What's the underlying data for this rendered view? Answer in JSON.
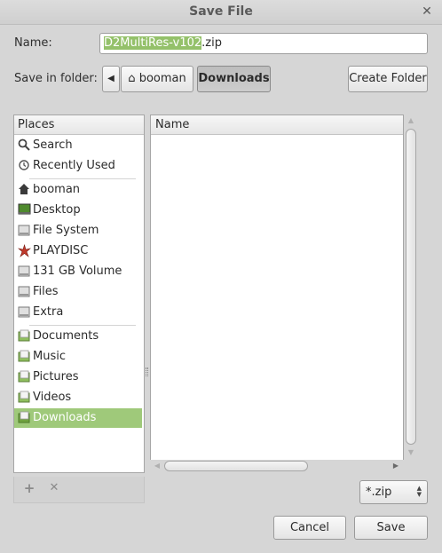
{
  "window": {
    "title": "Save File"
  },
  "name": {
    "label": "Name:",
    "value_selected": "D2MultiRes-v102",
    "value_ext": ".zip"
  },
  "folder": {
    "label": "Save in folder:",
    "back_icon": "triangle-left-icon",
    "crumbs": [
      {
        "label": "booman",
        "icon": "home-icon"
      },
      {
        "label": "Downloads"
      }
    ],
    "create_folder_label": "Create Folder"
  },
  "places": {
    "header": "Places",
    "items": [
      {
        "label": "Search",
        "icon": "search-icon"
      },
      {
        "label": "Recently Used",
        "icon": "recent-icon"
      },
      {
        "label": "booman",
        "icon": "home-icon"
      },
      {
        "label": "Desktop",
        "icon": "desktop-icon"
      },
      {
        "label": "File System",
        "icon": "drive-icon"
      },
      {
        "label": "PLAYDISC",
        "icon": "disc-icon"
      },
      {
        "label": "131 GB Volume",
        "icon": "drive-icon"
      },
      {
        "label": "Files",
        "icon": "drive-icon"
      },
      {
        "label": "Extra",
        "icon": "drive-icon"
      },
      {
        "label": "Documents",
        "icon": "folder-icon"
      },
      {
        "label": "Music",
        "icon": "folder-icon"
      },
      {
        "label": "Pictures",
        "icon": "folder-icon"
      },
      {
        "label": "Videos",
        "icon": "folder-icon"
      },
      {
        "label": "Downloads",
        "icon": "folder-icon",
        "selected": true
      }
    ],
    "add_icon": "plus-icon",
    "remove_icon": "x-icon"
  },
  "files": {
    "column_name": "Name",
    "rows": []
  },
  "filter": {
    "value": "*.zip"
  },
  "actions": {
    "cancel_label": "Cancel",
    "save_label": "Save"
  },
  "colors": {
    "accent": "#9fc97a",
    "selection": "#94c16a"
  }
}
